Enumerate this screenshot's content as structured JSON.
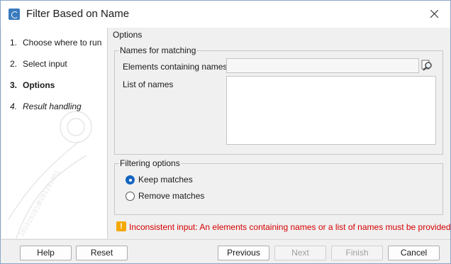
{
  "window": {
    "title": "Filter Based on Name",
    "app_icon": "clc-workbench-icon",
    "close_icon": "close-icon"
  },
  "steps": [
    {
      "number": "1.",
      "label": "Choose where to run",
      "state": "done"
    },
    {
      "number": "2.",
      "label": "Select input",
      "state": "done"
    },
    {
      "number": "3.",
      "label": "Options",
      "state": "active"
    },
    {
      "number": "4.",
      "label": "Result handling",
      "state": "future"
    }
  ],
  "options": {
    "section_title": "Options",
    "names_group": {
      "legend": "Names for matching",
      "elements_label": "Elements containing names",
      "elements_value": "",
      "list_label": "List of names",
      "list_value": "",
      "browse_icon": "browse-magnifier-icon"
    },
    "filtering_group": {
      "legend": "Filtering options",
      "keep_label": "Keep matches",
      "remove_label": "Remove matches",
      "selected": "keep"
    },
    "warning": {
      "icon": "warning-icon",
      "text": "Inconsistent input: An elements containing names or a list of names must be provided",
      "color": "#d60000"
    }
  },
  "buttons": {
    "help": "Help",
    "reset": "Reset",
    "previous": "Previous",
    "next": "Next",
    "finish": "Finish",
    "cancel": "Cancel"
  },
  "colors": {
    "accent": "#1565c0",
    "warning": "#f5a800"
  }
}
